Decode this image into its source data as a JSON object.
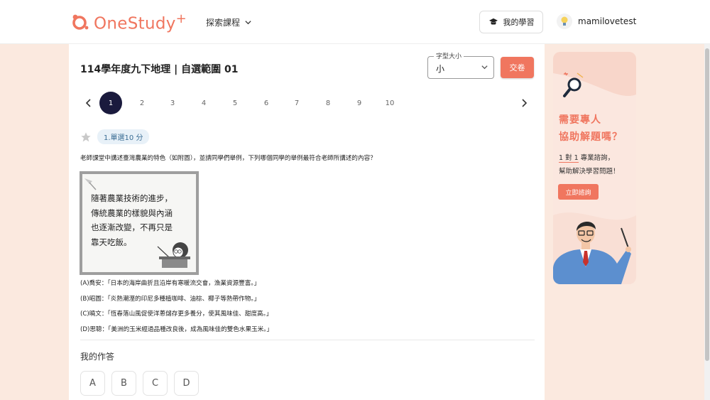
{
  "nav": {
    "logo_text": "OneStudy",
    "logo_plus": "+",
    "explore_label": "探索課程",
    "my_learning_label": "我的學習",
    "username": "mamilovetest"
  },
  "exam": {
    "title": "114學年度九下地理 | 自選範圍 01",
    "font_size_legend": "字型大小",
    "font_size_value": "小",
    "submit_label": "交卷",
    "pages": [
      "1",
      "2",
      "3",
      "4",
      "5",
      "6",
      "7",
      "8",
      "9",
      "10"
    ],
    "current_page": "1"
  },
  "question": {
    "tag": "1.單選10 分",
    "stem": "老師課堂中講述臺灣農業的特色（如附圖），並請同學們舉例，下列哪個同學的舉例最符合老師所講述的內容？",
    "figure_lines": [
      "隨著農業技術的進步，",
      "傳統農業的樣貌與內涵",
      "也逐漸改變，不再只是",
      "靠天吃飯。"
    ],
    "options": [
      "(A)喬安：「日本的海岸曲折且沿岸有寒暖流交會，漁業資源豐富。」",
      "(B)昭圖：「炎熱潮溼的印尼多種植咖啡、油棕、椰子等熱帶作物。」",
      "(C)曉文：「恆春落山風促使洋蔥儲存更多養分，使其風味佳、甜度高。」",
      "(D)思聰：「美洲的玉米經過品種改良後，成為風味佳的雙色水果玉米。」"
    ],
    "answer_label": "我的作答",
    "answer_choices": [
      "A",
      "B",
      "C",
      "D"
    ]
  },
  "ad": {
    "title_line1": "需要專人",
    "title_line2": "協助解題嗎？",
    "body_line1_pre": "1 對 1",
    "body_line1_post": " 專業諮詢，",
    "body_line2": "幫助解決學習問題！",
    "cta_label": "立即諮詢"
  },
  "colors": {
    "brand": "#f0765f",
    "active_page": "#1a1a3d",
    "page_bg": "#fbe9df"
  }
}
